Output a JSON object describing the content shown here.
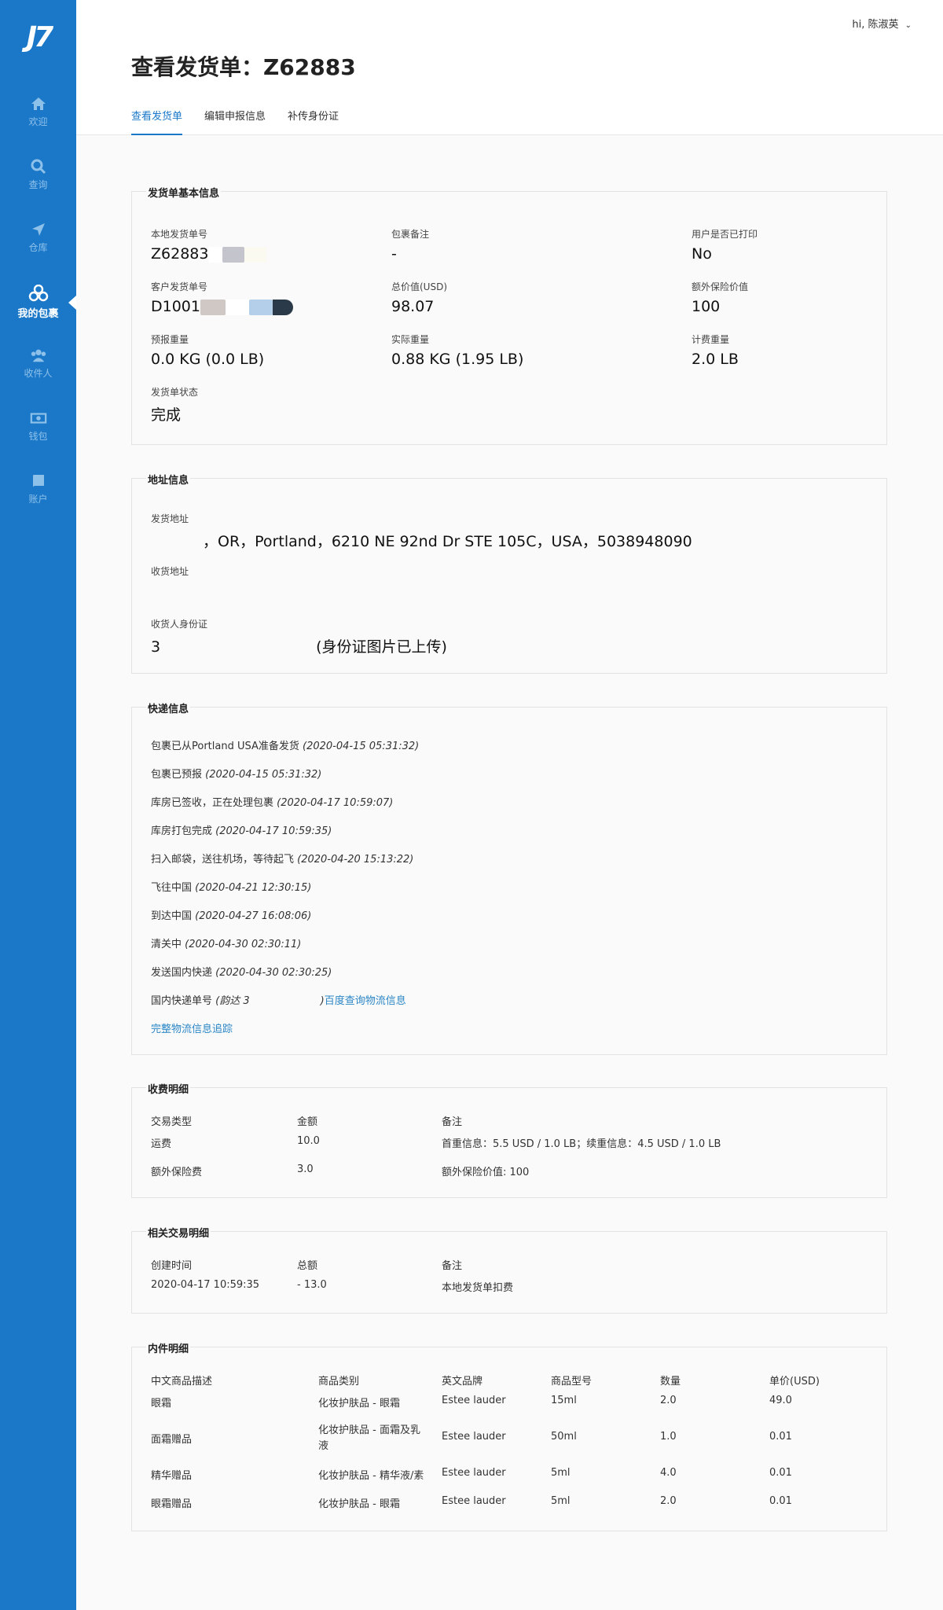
{
  "sidebar": {
    "logo": "J7",
    "items": [
      {
        "label": "欢迎",
        "icon": "home-icon"
      },
      {
        "label": "查询",
        "icon": "search-icon"
      },
      {
        "label": "仓库",
        "icon": "paper-plane-icon"
      },
      {
        "label": "我的包裹",
        "icon": "packages-icon",
        "active": true
      },
      {
        "label": "收件人",
        "icon": "users-icon"
      },
      {
        "label": "钱包",
        "icon": "money-icon"
      },
      {
        "label": "账户",
        "icon": "book-icon"
      }
    ]
  },
  "user": {
    "greeting": "hi, 陈淑英"
  },
  "header": {
    "title": "查看发货单：Z62883",
    "tabs": [
      "查看发货单",
      "编辑申报信息",
      "补传身份证"
    ]
  },
  "basic": {
    "title": "发货单基本信息",
    "local_no_label": "本地发货单号",
    "local_no": "Z62883",
    "note_label": "包裹备注",
    "note": "-",
    "printed_label": "用户是否已打印",
    "printed": "No",
    "client_no_label": "客户发货单号",
    "client_no": "D1001",
    "total_label": "总价值(USD)",
    "total": "98.07",
    "extra_ins_label": "额外保险价值",
    "extra_ins": "100",
    "est_weight_label": "预报重量",
    "est_weight": "0.0 KG (0.0 LB)",
    "actual_weight_label": "实际重量",
    "actual_weight": "0.88 KG (1.95 LB)",
    "bill_weight_label": "计费重量",
    "bill_weight": "2.0 LB",
    "status_label": "发货单状态",
    "status": "完成"
  },
  "address": {
    "title": "地址信息",
    "from_label": "发货地址",
    "from": "，OR，Portland，6210 NE 92nd Dr STE 105C，USA，5038948090",
    "to_label": "收货地址",
    "id_label": "收货人身份证",
    "id_prefix": "3",
    "id_suffix": "(身份证图片已上传)"
  },
  "tracking": {
    "title": "快递信息",
    "events": [
      {
        "text": "包裹已从Portland USA准备发货",
        "time": "(2020-04-15 05:31:32)"
      },
      {
        "text": "包裹已预报",
        "time": "(2020-04-15 05:31:32)"
      },
      {
        "text": "库房已签收，正在处理包裹",
        "time": "(2020-04-17 10:59:07)"
      },
      {
        "text": "库房打包完成",
        "time": "(2020-04-17 10:59:35)"
      },
      {
        "text": "扫入邮袋，送往机场，等待起飞",
        "time": "(2020-04-20 15:13:22)"
      },
      {
        "text": "飞往中国",
        "time": "(2020-04-21 12:30:15)"
      },
      {
        "text": "到达中国",
        "time": "(2020-04-27 16:08:06)"
      },
      {
        "text": "清关中",
        "time": "(2020-04-30 02:30:11)"
      },
      {
        "text": "发送国内快递",
        "time": "(2020-04-30 02:30:25)"
      }
    ],
    "domestic_label": "国内快递单号",
    "domestic_carrier": "(韵达 3",
    "domestic_close": ")",
    "baidu_link": "百度查询物流信息",
    "full_link": "完整物流信息追踪"
  },
  "fees": {
    "title": "收费明细",
    "headers": [
      "交易类型",
      "金额",
      "备注"
    ],
    "rows": [
      [
        "运费",
        "10.0",
        "首重信息：5.5 USD / 1.0 LB；续重信息：4.5 USD / 1.0 LB"
      ],
      [
        "额外保险费",
        "3.0",
        "额外保险价值: 100"
      ]
    ]
  },
  "transactions": {
    "title": "相关交易明细",
    "headers": [
      "创建时间",
      "总额",
      "备注"
    ],
    "rows": [
      [
        "2020-04-17 10:59:35",
        "- 13.0",
        "本地发货单扣费"
      ]
    ]
  },
  "items": {
    "title": "内件明细",
    "headers": [
      "中文商品描述",
      "商品类别",
      "英文品牌",
      "商品型号",
      "数量",
      "单价(USD)"
    ],
    "rows": [
      [
        "眼霜",
        "化妆护肤品 - 眼霜",
        "Estee lauder",
        "15ml",
        "2.0",
        "49.0"
      ],
      [
        "面霜赠品",
        "化妆护肤品 - 面霜及乳液",
        "Estee lauder",
        "50ml",
        "1.0",
        "0.01"
      ],
      [
        "精华赠品",
        "化妆护肤品 - 精华液/素",
        "Estee lauder",
        "5ml",
        "4.0",
        "0.01"
      ],
      [
        "眼霜赠品",
        "化妆护肤品 - 眼霜",
        "Estee lauder",
        "5ml",
        "2.0",
        "0.01"
      ]
    ]
  },
  "colors": {
    "sidebar": "#1b78c8",
    "link": "#2b86c6"
  }
}
